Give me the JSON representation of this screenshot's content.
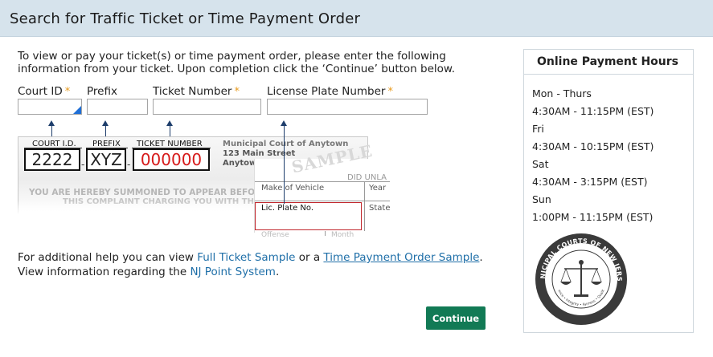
{
  "header": {
    "title": "Search for Traffic Ticket or Time Payment Order"
  },
  "intro": {
    "line1": "To view or pay your ticket(s) or time payment order, please enter the following",
    "line2": "information from your ticket. Upon completion click the ‘Continue’ button below."
  },
  "fields": {
    "court_id": {
      "label": "Court ID",
      "value": "",
      "required": "*"
    },
    "prefix": {
      "label": "Prefix",
      "value": ""
    },
    "ticket_number": {
      "label": "Ticket Number",
      "value": "",
      "required": "*"
    },
    "license_plate": {
      "label": "License Plate Number",
      "value": "",
      "required": "*"
    }
  },
  "sample_ticket": {
    "court_id_label": "COURT I.D.",
    "prefix_label": "PREFIX",
    "ticket_number_label": "TICKET NUMBER",
    "court_id_value": "2222",
    "prefix_value": "XYZ",
    "ticket_number_value": "000000",
    "court_name": "Municipal Court of Anytown",
    "court_address": "123 Main Street",
    "court_city": "Anytown",
    "watermark": "SAMPLE",
    "did_unlawfully": "DID UNLA",
    "make_of_vehicle": "Make of Vehicle",
    "year": "Year",
    "lic_plate": "Lic. Plate No.",
    "state": "State",
    "offense": "Offense",
    "month": "Month",
    "summon": "YOU ARE HEREBY SUMMONED TO APPEAR BEFORE T",
    "complaint": "THIS COMPLAINT CHARGING YOU WITH THE"
  },
  "help": {
    "prefix_text": "For additional help you can view ",
    "full_ticket_link": "Full Ticket Sample",
    "or_text": " or a ",
    "time_payment_link": "Time Payment Order Sample",
    "period": ".",
    "view_info_text": "View information regarding the ",
    "nj_point_link": "NJ Point System",
    "period2": "."
  },
  "continue_label": "Continue",
  "colors": {
    "header_bg": "#d6e3ec",
    "continue_bg": "#127a55",
    "link": "#1f6fa8",
    "required": "#e89b1e"
  },
  "hours": {
    "title": "Online Payment Hours",
    "lines": [
      "Mon - Thurs",
      "4:30AM - 11:15PM (EST)",
      "Fri",
      "4:30AM - 10:15PM (EST)",
      "Sat",
      "4:30AM - 3:15PM (EST)",
      "Sun",
      "1:00PM - 11:15PM (EST)"
    ]
  },
  "seal": {
    "ring_text": "MUNICIPAL COURTS OF NEW JERSEY",
    "inner_text": "Independence • Integrity • Fairness • Quality Service",
    "established": "Established 1948"
  }
}
